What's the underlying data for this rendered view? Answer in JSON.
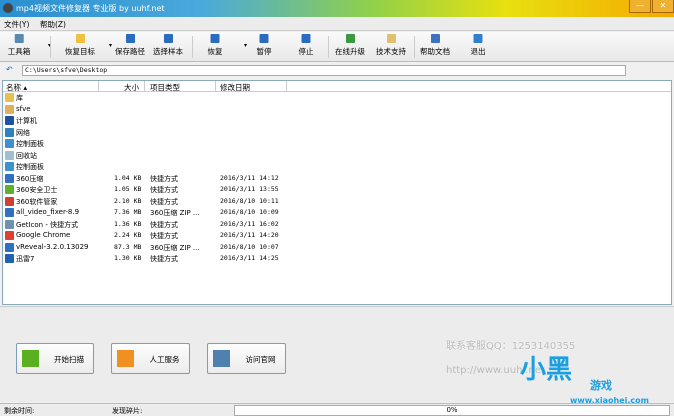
{
  "window": {
    "title": "mp4视频文件修复器 专业版 by uuhf.net",
    "minimize": "—",
    "close": "✕"
  },
  "menu": [
    "文件(Y)",
    "帮助(Z)"
  ],
  "toolbar": [
    {
      "label": "工具箱",
      "icon": "tools-icon",
      "color": "#5a8ab0",
      "dropdown": true
    },
    {
      "label": "恢复目标",
      "icon": "folder-open-icon",
      "color": "#f0c040",
      "dropdown": true
    },
    {
      "label": "保存路径",
      "icon": "save-icon",
      "color": "#2a6cc0"
    },
    {
      "label": "选择样本",
      "icon": "sample-icon",
      "color": "#2a6cc0"
    },
    {
      "label": "恢复",
      "icon": "play-icon",
      "color": "#2a6cc0",
      "dropdown": true
    },
    {
      "label": "暂停",
      "icon": "pause-icon",
      "color": "#2a6cc0"
    },
    {
      "label": "停止",
      "icon": "stop-icon",
      "color": "#2a6cc0"
    },
    {
      "label": "在线升级",
      "icon": "globe-icon",
      "color": "#3a9a40"
    },
    {
      "label": "技术支持",
      "icon": "support-icon",
      "color": "#e0c070"
    },
    {
      "label": "帮助文档",
      "icon": "help-icon",
      "color": "#4070c0"
    },
    {
      "label": "退出",
      "icon": "exit-icon",
      "color": "#3080d0"
    }
  ],
  "address": {
    "path": "C:\\Users\\sfve\\Desktop",
    "back": "↶"
  },
  "columns": {
    "name": "名称",
    "size": "大小",
    "type": "项目类型",
    "date": "修改日期"
  },
  "files": [
    {
      "name": "库",
      "size": "",
      "type": "",
      "date": "",
      "color": "#e8c050"
    },
    {
      "name": "sfve",
      "size": "",
      "type": "",
      "date": "",
      "color": "#e0b060"
    },
    {
      "name": "计算机",
      "size": "",
      "type": "",
      "date": "",
      "color": "#2050a0"
    },
    {
      "name": "网络",
      "size": "",
      "type": "",
      "date": "",
      "color": "#3080c0"
    },
    {
      "name": "控制面板",
      "size": "",
      "type": "",
      "date": "",
      "color": "#4090d0"
    },
    {
      "name": "回收站",
      "size": "",
      "type": "",
      "date": "",
      "color": "#a0c0d0"
    },
    {
      "name": "控制面板",
      "size": "",
      "type": "",
      "date": "",
      "color": "#4090d0"
    },
    {
      "name": "360压缩",
      "size": "1.04 KB",
      "type": "快捷方式",
      "date": "2016/3/11 14:12",
      "color": "#3070c0"
    },
    {
      "name": "360安全卫士",
      "size": "1.05 KB",
      "type": "快捷方式",
      "date": "2016/3/11 13:55",
      "color": "#60b030"
    },
    {
      "name": "360软件管家",
      "size": "2.10 KB",
      "type": "快捷方式",
      "date": "2016/8/10 10:11",
      "color": "#d04030"
    },
    {
      "name": "all_video_fixer-8.9",
      "size": "7.36 MB",
      "type": "360压缩 ZIP ...",
      "date": "2016/8/10 10:09",
      "color": "#3070c0"
    },
    {
      "name": "GetIcon - 快捷方式",
      "size": "1.36 KB",
      "type": "快捷方式",
      "date": "2016/3/11 16:02",
      "color": "#7090b0"
    },
    {
      "name": "Google Chrome",
      "size": "2.24 KB",
      "type": "快捷方式",
      "date": "2016/3/11 14:20",
      "color": "#e04030"
    },
    {
      "name": "vReveal-3.2.0.13029",
      "size": "87.3 MB",
      "type": "360压缩 ZIP ...",
      "date": "2016/8/10 10:07",
      "color": "#3070c0"
    },
    {
      "name": "迅雷7",
      "size": "1.30 KB",
      "type": "快捷方式",
      "date": "2016/3/11 14:25",
      "color": "#2060b0"
    }
  ],
  "actions": [
    {
      "label": "开始扫描",
      "icon": "check-icon",
      "color": "#5ab020"
    },
    {
      "label": "人工服务",
      "icon": "lightbulb-icon",
      "color": "#f09020"
    },
    {
      "label": "访问官网",
      "icon": "website-icon",
      "color": "#5080b0"
    }
  ],
  "contact": {
    "qq": "联系客服QQ：1253140355",
    "url": "http://www.uuhf.net"
  },
  "watermark": {
    "brand": "小黑",
    "sub": "游戏",
    "site": "www.xiaohei.com"
  },
  "status": {
    "remaining": "剩余时间:",
    "fragments": "发现碎片:",
    "progress": "0%",
    "progress_value": 0
  }
}
